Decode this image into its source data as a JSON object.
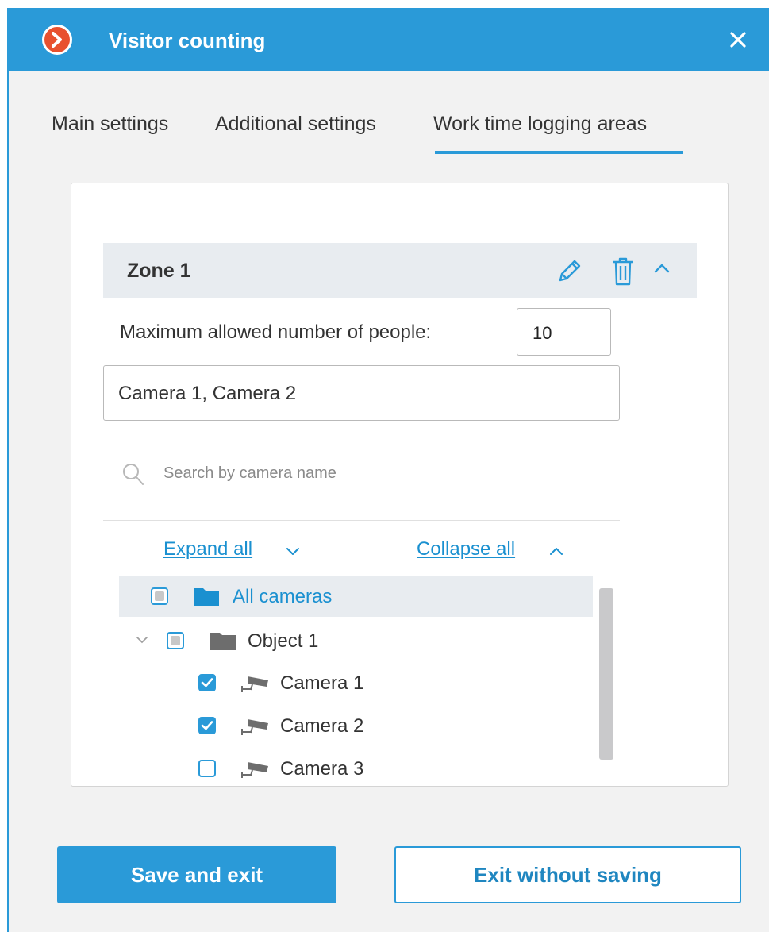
{
  "window": {
    "title": "Visitor counting",
    "accent_color": "#2a9ad8",
    "logo_color": "#e8512f"
  },
  "tabs": [
    {
      "label": "Main settings",
      "active": false
    },
    {
      "label": "Additional settings",
      "active": false
    },
    {
      "label": "Work time logging areas",
      "active": true
    }
  ],
  "zone": {
    "title": "Zone 1",
    "icons": [
      "pencil-icon",
      "trash-icon",
      "chevron-up-icon"
    ],
    "max_people_label": "Maximum allowed number of people:",
    "max_people_value": "10",
    "selected_cameras": "Camera 1, Camera 2"
  },
  "search": {
    "placeholder": "Search by camera name"
  },
  "links": {
    "expand_all": "Expand all",
    "collapse_all": "Collapse all"
  },
  "tree": [
    {
      "label": "All cameras",
      "state": "partial",
      "icon": "folder-icon",
      "selected": true
    },
    {
      "label": "Object 1",
      "state": "partial",
      "icon": "folder-icon",
      "expanded": true
    },
    {
      "label": "Camera 1",
      "state": "checked",
      "icon": "camera-icon"
    },
    {
      "label": "Camera 2",
      "state": "checked",
      "icon": "camera-icon"
    },
    {
      "label": "Camera 3",
      "state": "unchecked",
      "icon": "camera-icon"
    }
  ],
  "buttons": {
    "save": "Save and exit",
    "exit": "Exit without saving"
  }
}
